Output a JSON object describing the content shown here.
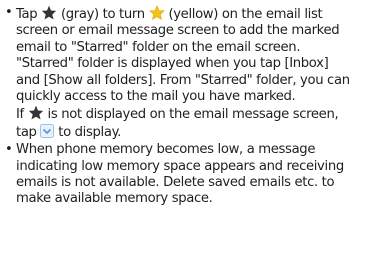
{
  "icons": {
    "star_gray": {
      "name": "gray-star-icon",
      "color": "#333333"
    },
    "star_yellow": {
      "name": "yellow-star-icon",
      "color": "#f2c21b"
    },
    "expand": {
      "name": "expand-chevron-icon",
      "color": "#7fb2e5"
    }
  },
  "bullets": [
    {
      "marker": "•",
      "lines": {
        "l1_a": "Tap",
        "l1_b": "(gray) to turn",
        "l1_c": "(yellow) on the email list",
        "l2": "screen or email message screen to add the marked",
        "l3": "email to \"Starred\" folder on the email screen.",
        "l4": "\"Starred\" folder is displayed when you tap [Inbox]",
        "l5": "and [Show all folders]. From \"Starred\" folder, you can",
        "l6": "quickly access to the mail you have marked.",
        "l7_a": "If",
        "l7_b": "is not displayed on the email message screen,",
        "l8_a": "tap",
        "l8_b": "to display."
      }
    },
    {
      "marker": "•",
      "lines": {
        "l1": "When phone memory becomes low, a message",
        "l2": "indicating low memory space appears and receiving",
        "l3": "emails is not available. Delete saved emails etc. to",
        "l4": "make available memory space."
      }
    }
  ]
}
